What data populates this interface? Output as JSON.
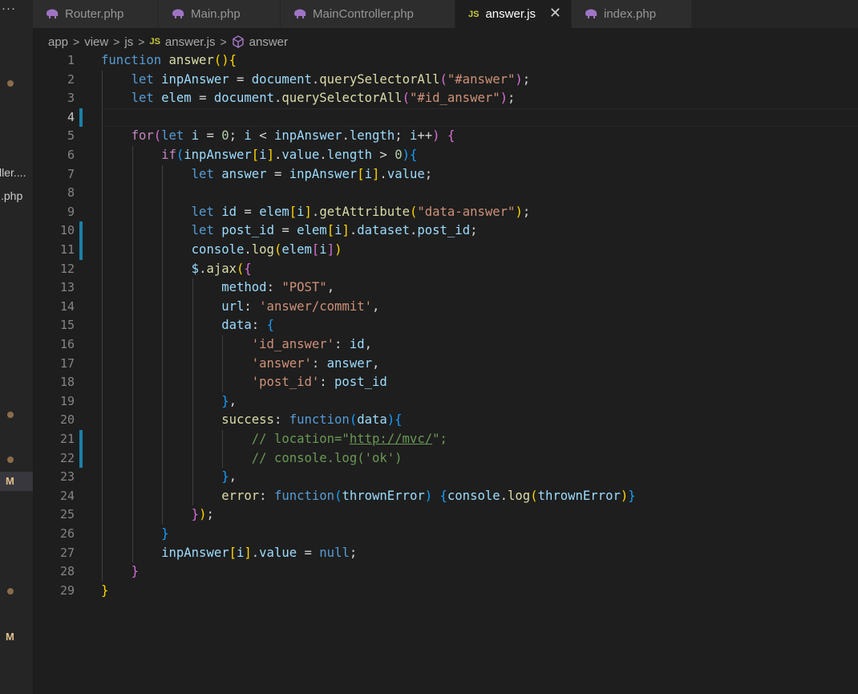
{
  "sidebar": {
    "more_label": "···",
    "files": [
      {
        "name": "ller...."
      },
      {
        "name": ".php"
      }
    ],
    "badges": [
      "M",
      "M"
    ]
  },
  "tabs": [
    {
      "label": "Router.php",
      "icon": "php-elephant-icon",
      "active": false
    },
    {
      "label": "Main.php",
      "icon": "php-elephant-icon",
      "active": false
    },
    {
      "label": "MainController.php",
      "icon": "php-elephant-icon",
      "active": false
    },
    {
      "label": "answer.js",
      "icon": "js-icon",
      "active": true
    },
    {
      "label": "index.php",
      "icon": "php-elephant-icon",
      "active": false
    }
  ],
  "breadcrumb": {
    "parts": [
      "app",
      "view",
      "js",
      "answer.js",
      "answer"
    ],
    "js_badge": "JS"
  },
  "editor": {
    "current_line": 4,
    "modified_lines": [
      4,
      10,
      11,
      21,
      22
    ],
    "line_count": 29
  },
  "colors": {
    "keyword": "#569cd6",
    "control": "#c586c0",
    "function": "#dcdcaa",
    "variable": "#9cdcfe",
    "string": "#ce9178",
    "number": "#b5cea8",
    "comment": "#6a9955",
    "gutter_modified": "#1b81a8",
    "php_icon": "#a074c4",
    "js_icon": "#cbcb41"
  },
  "code_lines": [
    [
      [
        "kw",
        "function"
      ],
      [
        "p",
        " "
      ],
      [
        "fn",
        "answer"
      ],
      [
        "br1",
        "()"
      ],
      [
        "br1",
        "{"
      ]
    ],
    [
      [
        "p",
        "    "
      ],
      [
        "kw",
        "let"
      ],
      [
        "p",
        " "
      ],
      [
        "var",
        "inpAnswer"
      ],
      [
        "p",
        " = "
      ],
      [
        "var",
        "document"
      ],
      [
        "p",
        "."
      ],
      [
        "fn",
        "querySelectorAll"
      ],
      [
        "br2",
        "("
      ],
      [
        "str",
        "\"#answer\""
      ],
      [
        "br2",
        ")"
      ],
      [
        "p",
        ";"
      ]
    ],
    [
      [
        "p",
        "    "
      ],
      [
        "kw",
        "let"
      ],
      [
        "p",
        " "
      ],
      [
        "var",
        "elem"
      ],
      [
        "p",
        " = "
      ],
      [
        "var",
        "document"
      ],
      [
        "p",
        "."
      ],
      [
        "fn",
        "querySelectorAll"
      ],
      [
        "br2",
        "("
      ],
      [
        "str",
        "\"#id_answer\""
      ],
      [
        "br2",
        ")"
      ],
      [
        "p",
        ";"
      ]
    ],
    [
      [
        "p",
        ""
      ]
    ],
    [
      [
        "p",
        "    "
      ],
      [
        "ctl",
        "for"
      ],
      [
        "br2",
        "("
      ],
      [
        "kw",
        "let"
      ],
      [
        "p",
        " "
      ],
      [
        "var",
        "i"
      ],
      [
        "p",
        " = "
      ],
      [
        "num",
        "0"
      ],
      [
        "p",
        "; "
      ],
      [
        "var",
        "i"
      ],
      [
        "p",
        " < "
      ],
      [
        "var",
        "inpAnswer"
      ],
      [
        "p",
        "."
      ],
      [
        "var",
        "length"
      ],
      [
        "p",
        "; "
      ],
      [
        "var",
        "i"
      ],
      [
        "p",
        "++"
      ],
      [
        "br2",
        ")"
      ],
      [
        "p",
        " "
      ],
      [
        "br2",
        "{"
      ]
    ],
    [
      [
        "p",
        "        "
      ],
      [
        "ctl",
        "if"
      ],
      [
        "br3",
        "("
      ],
      [
        "var",
        "inpAnswer"
      ],
      [
        "br1",
        "["
      ],
      [
        "var",
        "i"
      ],
      [
        "br1",
        "]"
      ],
      [
        "p",
        "."
      ],
      [
        "var",
        "value"
      ],
      [
        "p",
        "."
      ],
      [
        "var",
        "length"
      ],
      [
        "p",
        " > "
      ],
      [
        "num",
        "0"
      ],
      [
        "br3",
        ")"
      ],
      [
        "br3",
        "{"
      ]
    ],
    [
      [
        "p",
        "            "
      ],
      [
        "kw",
        "let"
      ],
      [
        "p",
        " "
      ],
      [
        "var",
        "answer"
      ],
      [
        "p",
        " = "
      ],
      [
        "var",
        "inpAnswer"
      ],
      [
        "br1",
        "["
      ],
      [
        "var",
        "i"
      ],
      [
        "br1",
        "]"
      ],
      [
        "p",
        "."
      ],
      [
        "var",
        "value"
      ],
      [
        "p",
        ";"
      ]
    ],
    [
      [
        "p",
        ""
      ]
    ],
    [
      [
        "p",
        "            "
      ],
      [
        "kw",
        "let"
      ],
      [
        "p",
        " "
      ],
      [
        "var",
        "id"
      ],
      [
        "p",
        " = "
      ],
      [
        "var",
        "elem"
      ],
      [
        "br1",
        "["
      ],
      [
        "var",
        "i"
      ],
      [
        "br1",
        "]"
      ],
      [
        "p",
        "."
      ],
      [
        "fn",
        "getAttribute"
      ],
      [
        "br1",
        "("
      ],
      [
        "str",
        "\"data-answer\""
      ],
      [
        "br1",
        ")"
      ],
      [
        "p",
        ";"
      ]
    ],
    [
      [
        "p",
        "            "
      ],
      [
        "kw",
        "let"
      ],
      [
        "p",
        " "
      ],
      [
        "var",
        "post_id"
      ],
      [
        "p",
        " = "
      ],
      [
        "var",
        "elem"
      ],
      [
        "br1",
        "["
      ],
      [
        "var",
        "i"
      ],
      [
        "br1",
        "]"
      ],
      [
        "p",
        "."
      ],
      [
        "var",
        "dataset"
      ],
      [
        "p",
        "."
      ],
      [
        "var",
        "post_id"
      ],
      [
        "p",
        ";"
      ]
    ],
    [
      [
        "p",
        "            "
      ],
      [
        "var",
        "console"
      ],
      [
        "p",
        "."
      ],
      [
        "fn",
        "log"
      ],
      [
        "br1",
        "("
      ],
      [
        "var",
        "elem"
      ],
      [
        "br2",
        "["
      ],
      [
        "var",
        "i"
      ],
      [
        "br2",
        "]"
      ],
      [
        "br1",
        ")"
      ]
    ],
    [
      [
        "p",
        "            "
      ],
      [
        "var",
        "$"
      ],
      [
        "p",
        "."
      ],
      [
        "fn",
        "ajax"
      ],
      [
        "br1",
        "("
      ],
      [
        "br2",
        "{"
      ]
    ],
    [
      [
        "p",
        "                "
      ],
      [
        "var",
        "method"
      ],
      [
        "p",
        ": "
      ],
      [
        "str",
        "\"POST\""
      ],
      [
        "p",
        ","
      ]
    ],
    [
      [
        "p",
        "                "
      ],
      [
        "var",
        "url"
      ],
      [
        "p",
        ": "
      ],
      [
        "str",
        "'answer/commit'"
      ],
      [
        "p",
        ","
      ]
    ],
    [
      [
        "p",
        "                "
      ],
      [
        "var",
        "data"
      ],
      [
        "p",
        ": "
      ],
      [
        "br3",
        "{"
      ]
    ],
    [
      [
        "p",
        "                    "
      ],
      [
        "str",
        "'id_answer'"
      ],
      [
        "p",
        ": "
      ],
      [
        "var",
        "id"
      ],
      [
        "p",
        ","
      ]
    ],
    [
      [
        "p",
        "                    "
      ],
      [
        "str",
        "'answer'"
      ],
      [
        "p",
        ": "
      ],
      [
        "var",
        "answer"
      ],
      [
        "p",
        ","
      ]
    ],
    [
      [
        "p",
        "                    "
      ],
      [
        "str",
        "'post_id'"
      ],
      [
        "p",
        ": "
      ],
      [
        "var",
        "post_id"
      ]
    ],
    [
      [
        "p",
        "                "
      ],
      [
        "br3",
        "}"
      ],
      [
        "p",
        ","
      ]
    ],
    [
      [
        "p",
        "                "
      ],
      [
        "fn",
        "success"
      ],
      [
        "p",
        ": "
      ],
      [
        "kw",
        "function"
      ],
      [
        "br3",
        "("
      ],
      [
        "var",
        "data"
      ],
      [
        "br3",
        ")"
      ],
      [
        "br3",
        "{"
      ]
    ],
    [
      [
        "p",
        "                    "
      ],
      [
        "cm",
        "// location=\""
      ],
      [
        "cmu",
        "http://mvc/"
      ],
      [
        "cm",
        "\";"
      ]
    ],
    [
      [
        "p",
        "                    "
      ],
      [
        "cm",
        "// console.log('ok')"
      ]
    ],
    [
      [
        "p",
        "                "
      ],
      [
        "br3",
        "}"
      ],
      [
        "p",
        ","
      ]
    ],
    [
      [
        "p",
        "                "
      ],
      [
        "fn",
        "error"
      ],
      [
        "p",
        ": "
      ],
      [
        "kw",
        "function"
      ],
      [
        "br3",
        "("
      ],
      [
        "var",
        "thrownError"
      ],
      [
        "br3",
        ")"
      ],
      [
        "p",
        " "
      ],
      [
        "br3",
        "{"
      ],
      [
        "var",
        "console"
      ],
      [
        "p",
        "."
      ],
      [
        "fn",
        "log"
      ],
      [
        "br1",
        "("
      ],
      [
        "var",
        "thrownError"
      ],
      [
        "br1",
        ")"
      ],
      [
        "br3",
        "}"
      ]
    ],
    [
      [
        "p",
        "            "
      ],
      [
        "br2",
        "}"
      ],
      [
        "br1",
        ")"
      ],
      [
        "p",
        ";"
      ]
    ],
    [
      [
        "p",
        "        "
      ],
      [
        "br3",
        "}"
      ]
    ],
    [
      [
        "p",
        "        "
      ],
      [
        "var",
        "inpAnswer"
      ],
      [
        "br1",
        "["
      ],
      [
        "var",
        "i"
      ],
      [
        "br1",
        "]"
      ],
      [
        "p",
        "."
      ],
      [
        "var",
        "value"
      ],
      [
        "p",
        " = "
      ],
      [
        "kw",
        "null"
      ],
      [
        "p",
        ";"
      ]
    ],
    [
      [
        "p",
        "    "
      ],
      [
        "br2",
        "}"
      ]
    ],
    [
      [
        "br1",
        "}"
      ]
    ]
  ]
}
